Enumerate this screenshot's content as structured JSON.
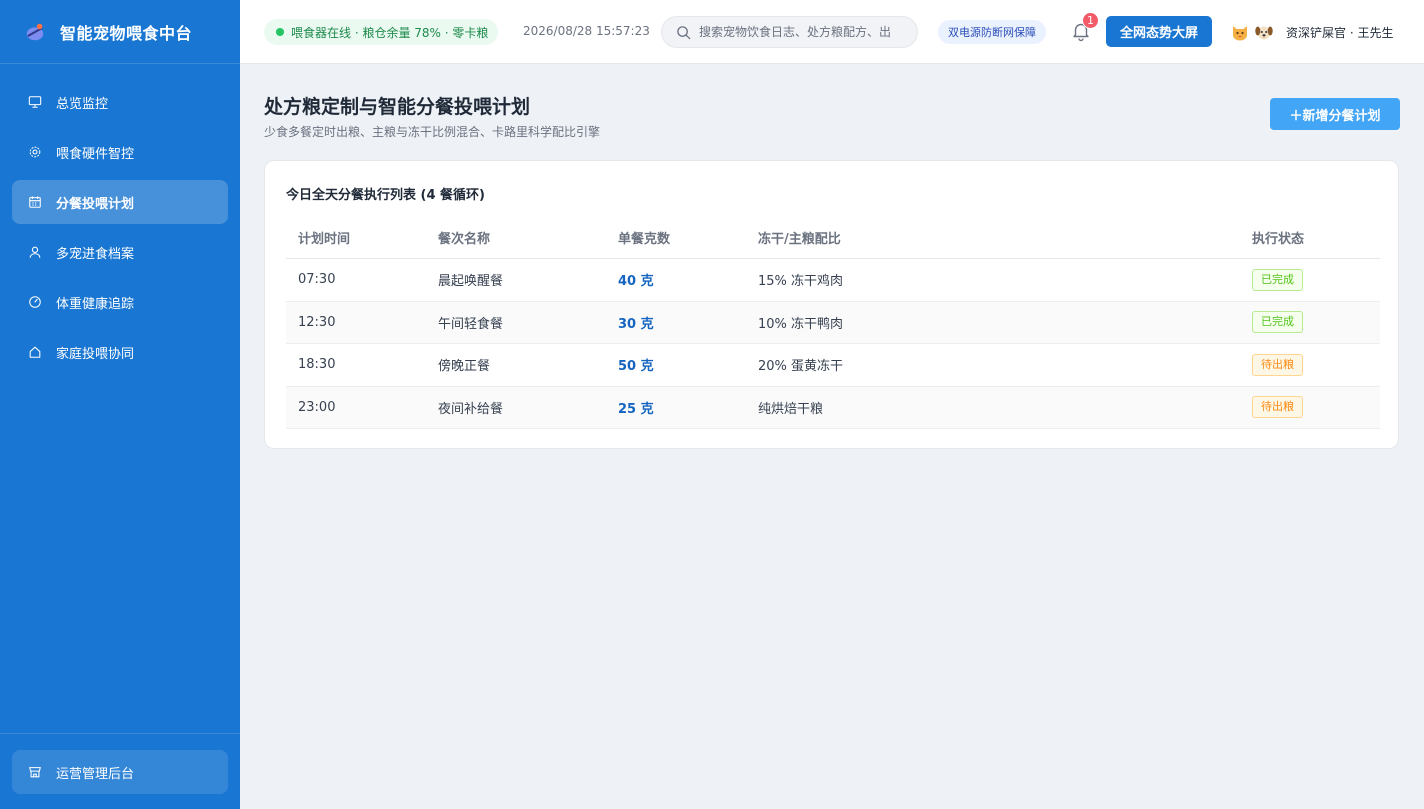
{
  "sidebar": {
    "title": "智能宠物喂食中台",
    "items": [
      {
        "label": "总览监控",
        "icon": "monitor-icon",
        "active": false
      },
      {
        "label": "喂食硬件智控",
        "icon": "gear-icon",
        "active": false
      },
      {
        "label": "分餐投喂计划",
        "icon": "calendar-icon",
        "active": true
      },
      {
        "label": "多宠进食档案",
        "icon": "user-icon",
        "active": false
      },
      {
        "label": "体重健康追踪",
        "icon": "gauge-icon",
        "active": false
      },
      {
        "label": "家庭投喂协同",
        "icon": "home-icon",
        "active": false
      }
    ],
    "bottom_label": "运营管理后台"
  },
  "header": {
    "status": "喂食器在线 · 粮仓余量 78% · 零卡粮",
    "datetime": "2026/08/28 15:57:23",
    "search_placeholder": "搜索宠物饮食日志、处方粮配方、出",
    "power_badge": "双电源防断网保障",
    "notification_count": "1",
    "bigscreen_label": "全网态势大屏",
    "username": "资深铲屎官 · 王先生"
  },
  "main": {
    "title": "处方粮定制与智能分餐投喂计划",
    "subtitle": "少食多餐定时出粮、主粮与冻干比例混合、卡路里科学配比引擎",
    "add_button": "＋新增分餐计划",
    "card_title": "今日全天分餐执行列表 (4 餐循环)",
    "columns": [
      "计划时间",
      "餐次名称",
      "单餐克数",
      "冻干/主粮配比",
      "执行状态"
    ],
    "rows": [
      {
        "time": "07:30",
        "meal": "晨起唤醒餐",
        "grams": "40 克",
        "ratio": "15% 冻干鸡肉",
        "status": "已完成",
        "status_type": "done"
      },
      {
        "time": "12:30",
        "meal": "午间轻食餐",
        "grams": "30 克",
        "ratio": "10% 冻干鸭肉",
        "status": "已完成",
        "status_type": "done"
      },
      {
        "time": "18:30",
        "meal": "傍晚正餐",
        "grams": "50 克",
        "ratio": "20% 蛋黄冻干",
        "status": "待出粮",
        "status_type": "pending"
      },
      {
        "time": "23:00",
        "meal": "夜间补给餐",
        "grams": "25 克",
        "ratio": "纯烘焙干粮",
        "status": "待出粮",
        "status_type": "pending"
      }
    ]
  },
  "colors": {
    "sidebar_bg": "#1976d2",
    "accent": "#1976d2",
    "add_button_bg": "#42a5f5",
    "done": "#52c41a",
    "pending": "#fa8c16"
  }
}
